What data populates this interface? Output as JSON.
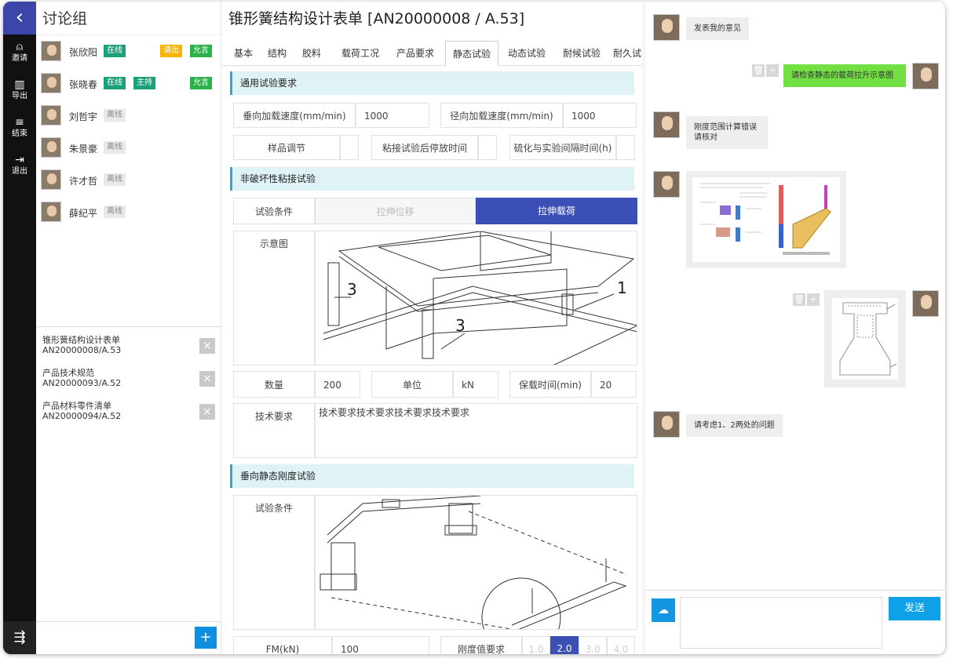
{
  "nav": {
    "back_icon": "chevron-left-icon",
    "items": [
      {
        "icon": "person-add-icon",
        "glyph": "⍝",
        "label": "邀请"
      },
      {
        "icon": "export-icon",
        "glyph": "▥",
        "label": "导出"
      },
      {
        "icon": "end-icon",
        "glyph": "≡",
        "label": "结束"
      },
      {
        "icon": "logout-icon",
        "glyph": "⇥",
        "label": "退出"
      }
    ],
    "menu_icon": "menu-icon"
  },
  "panel": {
    "title": "讨论组",
    "members": [
      {
        "name": "张欣阳",
        "status": "在线",
        "role": "",
        "kick": "请出",
        "allow": "允言"
      },
      {
        "name": "张晓春",
        "status": "在线",
        "role": "主持",
        "kick": "",
        "allow": "允言"
      },
      {
        "name": "刘哲宇",
        "status": "离线",
        "role": "",
        "kick": "",
        "allow": ""
      },
      {
        "name": "朱景豪",
        "status": "离线",
        "role": "",
        "kick": "",
        "allow": ""
      },
      {
        "name": "许才哲",
        "status": "离线",
        "role": "",
        "kick": "",
        "allow": ""
      },
      {
        "name": "薛纪平",
        "status": "离线",
        "role": "",
        "kick": "",
        "allow": ""
      }
    ],
    "docs": [
      {
        "title": "锥形簧结构设计表单",
        "code": "AN20000008/A.53"
      },
      {
        "title": "产品技术规范",
        "code": "AN20000093/A.52"
      },
      {
        "title": "产品材料零件清单",
        "code": "AN20000094/A.52"
      }
    ],
    "add_label": "+"
  },
  "form": {
    "title": "锥形簧结构设计表单 [AN20000008 / A.53]",
    "tabs": [
      "基本",
      "结构",
      "胶料",
      "载荷工况",
      "产品要求",
      "静态试验",
      "动态试验",
      "耐候试验",
      "耐久试"
    ],
    "active_tab": "静态试验",
    "sec1": "通用试验要求",
    "vert_speed_label": "垂向加载速度(mm/min)",
    "vert_speed_value": "1000",
    "rad_speed_label": "径向加载速度(mm/min)",
    "rad_speed_value": "1000",
    "sample_adjust_label": "样品调节",
    "sample_adjust_value": "",
    "bond_park_label": "粘接试验后停放时间",
    "bond_park_value": "",
    "vulc_interval_label": "硫化与实验间隔时间(h)",
    "vulc_interval_value": "",
    "sec2": "非破坏性粘接试验",
    "test_cond_label": "试验条件",
    "cond_options": [
      "拉伸位移",
      "拉伸载荷"
    ],
    "cond_selected": "拉伸载荷",
    "diagram_label": "示意图",
    "qty_label": "数量",
    "qty_value": "200",
    "unit_label": "单位",
    "unit_value": "kN",
    "hold_time_label": "保载时间(min)",
    "hold_time_value": "20",
    "tech_req_label": "技术要求",
    "tech_req_value": "技术要求技术要求技术要求技术要求",
    "sec3": "垂向静态刚度试验",
    "test_cond2_label": "试验条件",
    "fm_label": "FM(kN)",
    "fm_value": "100",
    "stiff_label": "刚度值要求",
    "stiff_options": [
      "1.0",
      "2.0",
      "3.0",
      "4.0"
    ],
    "stiff_selected": "2.0",
    "callouts": [
      "3",
      "3",
      "1"
    ]
  },
  "chat": {
    "messages": [
      {
        "side": "left",
        "text": "发表我的意见"
      },
      {
        "side": "right",
        "text": "请检查静态的载荷拉升示意图"
      },
      {
        "side": "left",
        "text": "刚度范围计算错误\n请核对"
      },
      {
        "side": "left",
        "type": "image"
      },
      {
        "side": "right",
        "type": "image"
      },
      {
        "side": "left",
        "text": "请考虑1、2两处的问题"
      }
    ],
    "send_label": "发送",
    "upload_icon": "cloud-upload-icon",
    "colors": {
      "mine": "#72e042",
      "theirs": "#eeeeee",
      "accent": "#0ea0e8"
    }
  }
}
